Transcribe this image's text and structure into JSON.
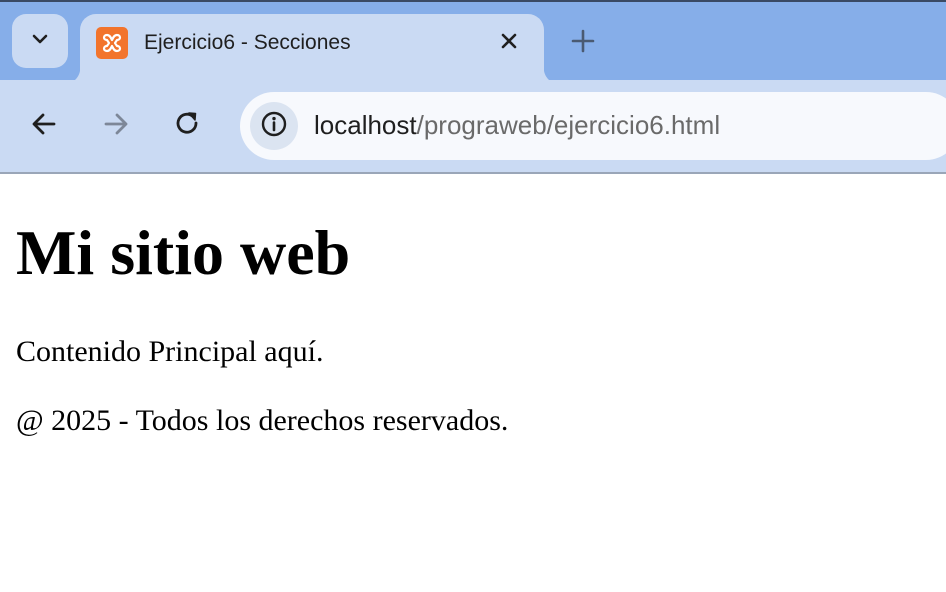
{
  "browser": {
    "tab": {
      "title": "Ejercicio6 - Secciones"
    },
    "address_bar": {
      "host": "localhost",
      "path": "/prograweb/ejercicio6.html"
    },
    "colors": {
      "tab_strip": "#86aee9",
      "toolbar": "#cadaf3",
      "omnibox": "#f7f9fd",
      "favicon": "#f2742c"
    },
    "icons": [
      "tab-search-icon",
      "xampp-favicon-icon",
      "close-icon",
      "plus-icon",
      "back-arrow-icon",
      "forward-arrow-icon",
      "reload-icon",
      "site-info-icon"
    ]
  },
  "page": {
    "heading": "Mi sitio web",
    "main_text": "Contenido Principal aquí.",
    "footer_text": "@ 2025 - Todos los derechos reservados."
  }
}
